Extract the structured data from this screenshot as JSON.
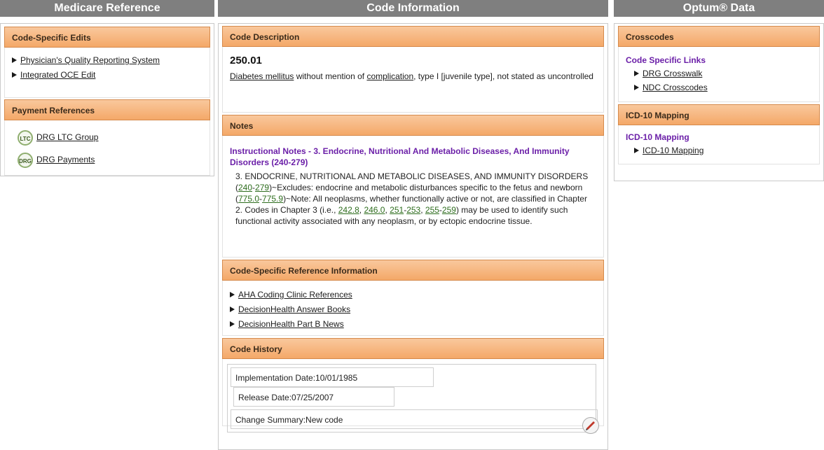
{
  "left": {
    "header": "Medicare Reference",
    "edits": {
      "title": "Code-Specific Edits",
      "items": [
        "Physician's Quality Reporting System",
        "Integrated OCE Edit"
      ]
    },
    "payments": {
      "title": "Payment References",
      "items": [
        {
          "badge": "LTC",
          "label": "DRG LTC Group"
        },
        {
          "badge": "DRG",
          "label": "DRG Payments"
        }
      ]
    }
  },
  "center": {
    "header": "Code Information",
    "description": {
      "title": "Code Description",
      "code": "250.01",
      "link1": "Diabetes mellitus",
      "text1": " without mention of ",
      "link2": "complication",
      "text2": ", type I [juvenile type], not stated as uncontrolled"
    },
    "notes": {
      "title": "Notes",
      "heading": "Instructional Notes - 3. Endocrine, Nutritional And Metabolic Diseases, And Immunity Disorders (240-279)",
      "t1": "3. ENDOCRINE, NUTRITIONAL AND METABOLIC DISEASES, AND IMMUNITY DISORDERS (",
      "l1": "240",
      "d1": "-",
      "l2": "279",
      "t2": ")~Excludes: endocrine and metabolic disturbances specific to the fetus and newborn (",
      "l3": "775.0",
      "d2": "-",
      "l4": "775.9",
      "t3": ")~Note: All neoplasms, whether functionally active or not, are classified in Chapter 2. Codes in Chapter 3 (i.e., ",
      "l5": "242.8",
      "c1": ", ",
      "l6": "246.0",
      "c2": ", ",
      "l7": "251",
      "d3": "-",
      "l8": "253",
      "c3": ", ",
      "l9": "255",
      "d4": "-",
      "l10": "259",
      "t4": ") may be used to identify such functional activity associated with any neoplasm, or by ectopic endocrine tissue."
    },
    "reference": {
      "title": "Code-Specific Reference Information",
      "items": [
        "AHA Coding Clinic References",
        "DecisionHealth Answer Books",
        "DecisionHealth Part B News"
      ]
    },
    "history": {
      "title": "Code History",
      "implementation": "Implementation Date:10/01/1985",
      "release": "Release Date:07/25/2007",
      "change": "Change Summary:New code"
    }
  },
  "right": {
    "header": "Optum® Data",
    "crosscodes": {
      "title": "Crosscodes",
      "subheading": "Code Specific Links",
      "items": [
        "DRG Crosswalk",
        "NDC Crosscodes"
      ]
    },
    "icd10": {
      "title": "ICD-10 Mapping",
      "subheading": "ICD-10 Mapping",
      "items": [
        "ICD-10 Mapping"
      ]
    }
  }
}
